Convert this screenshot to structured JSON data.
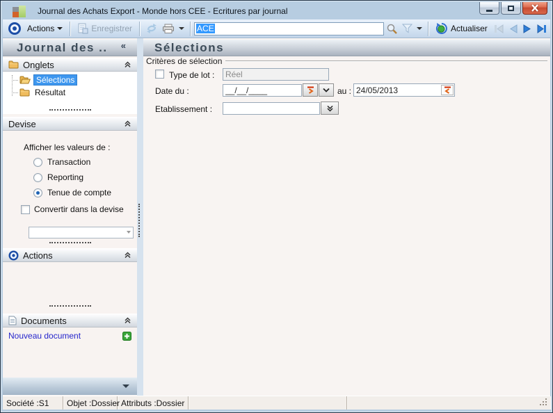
{
  "window": {
    "title": "Journal des Achats Export  -  Monde hors CEE -  Ecritures par journal"
  },
  "toolbar": {
    "actions_label": "Actions",
    "save_label": "Enregistrer",
    "search_value": "ACE",
    "refresh_label": "Actualiser"
  },
  "sidebar": {
    "header_title": "Journal  des ..",
    "collapse_glyph": "«",
    "onglets": {
      "title": "Onglets",
      "items": [
        {
          "label": "Sélections",
          "selected": true
        },
        {
          "label": "Résultat",
          "selected": false
        }
      ]
    },
    "devise": {
      "title": "Devise",
      "show_values_label": "Afficher les valeurs de :",
      "options": [
        {
          "label": "Transaction",
          "checked": false
        },
        {
          "label": "Reporting",
          "checked": false
        },
        {
          "label": "Tenue de compte",
          "checked": true
        }
      ],
      "convert_label": "Convertir dans la devise",
      "currency_value": ""
    },
    "actions_section": {
      "title": "Actions"
    },
    "documents": {
      "title": "Documents",
      "new_document_label": "Nouveau document"
    }
  },
  "main": {
    "title": "Sélections",
    "criteria_legend": "Critères de sélection",
    "type_lot_label": "Type de lot :",
    "type_lot_value": "Réel",
    "type_lot_checked": false,
    "date_du_label": "Date du :",
    "date_du_value": "__/__/____",
    "au_label": "au :",
    "au_value": "24/05/2013",
    "etablissement_label": "Etablissement :",
    "etablissement_value": ""
  },
  "statusbar": {
    "societe": "Société :S1",
    "objet": "Objet :Dossier",
    "attributs": "Attributs :Dossier"
  },
  "colors": {
    "selection_blue": "#3e97ef",
    "header_text": "#3d4c59",
    "link_blue": "#2626cc",
    "plus_green": "#3aa53a",
    "arrow_orange": "#e2661c",
    "arrow_bar_red": "#d22b00",
    "nav_blue": "#2e7ed8",
    "close_red": "#d8604a"
  }
}
